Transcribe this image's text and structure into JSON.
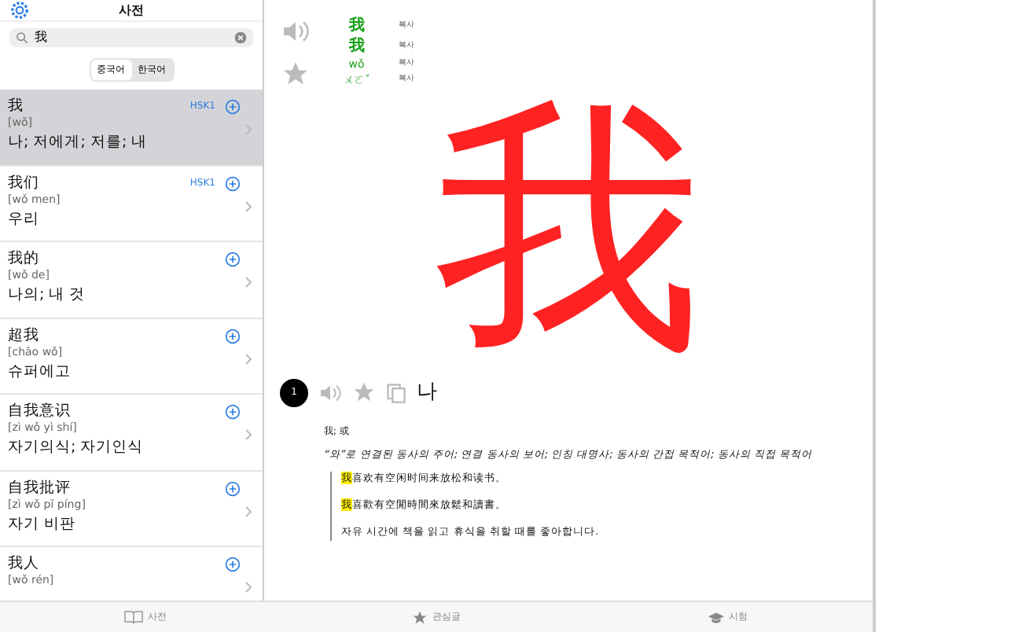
{
  "sidebar": {
    "title": "사전",
    "search": {
      "value": "我"
    },
    "segments": [
      {
        "label": "중국어",
        "selected": true
      },
      {
        "label": "한국어",
        "selected": false
      }
    ],
    "items": [
      {
        "word": "我",
        "pinyin": "[wǒ]",
        "meaning": "나; 저에게; 저를; 내",
        "hsk": "HSK1",
        "selected": true
      },
      {
        "word": "我们",
        "pinyin": "[wǒ men]",
        "meaning": "우리",
        "hsk": "HSK1",
        "selected": false
      },
      {
        "word": "我的",
        "pinyin": "[wǒ de]",
        "meaning": "나의; 내 것",
        "selected": false
      },
      {
        "word": "超我",
        "pinyin": "[chāo wǒ]",
        "meaning": "슈퍼에고",
        "selected": false
      },
      {
        "word": "自我意识",
        "pinyin": "[zì wǒ yì shí]",
        "meaning": "자기의식; 자기인식",
        "selected": false
      },
      {
        "word": "自我批评",
        "pinyin": "[zì wǒ pī píng]",
        "meaning": "자기 비판",
        "selected": false
      },
      {
        "word": "我人",
        "pinyin": "[wǒ rén]",
        "selected": false
      }
    ]
  },
  "entry": {
    "forms": [
      {
        "text": "我",
        "kind": "hanzi",
        "copy": "복사"
      },
      {
        "text": "我",
        "kind": "hanzi",
        "copy": "복사"
      },
      {
        "text": "wǒ",
        "kind": "pinyin",
        "copy": "복사"
      },
      {
        "text": "ㄨㄛˇ",
        "kind": "zhuyin",
        "copy": "복사"
      }
    ],
    "character": "我",
    "senses": [
      {
        "number": "1",
        "meaning": "나",
        "chars": "我; 或",
        "description": "“와”로 연결된 동사의 주어; 연결 동사의 보어; 인칭 대명사; 동사의 간접 목적어; 동사의 직접 목적어",
        "examples": [
          {
            "highlight": "我",
            "rest": "喜欢有空闲时间来放松和读书。"
          },
          {
            "highlight": "我",
            "rest": "喜歡有空閒時間來放鬆和讀書。"
          },
          {
            "rest": "자유 시간에 책을 읽고 휴식을 취할 때를 좋아합니다."
          }
        ]
      }
    ]
  },
  "tab_bar": [
    {
      "label": "사전",
      "selected": false
    },
    {
      "label": "관심글",
      "selected": false
    },
    {
      "label": "시험",
      "selected": false
    }
  ]
}
